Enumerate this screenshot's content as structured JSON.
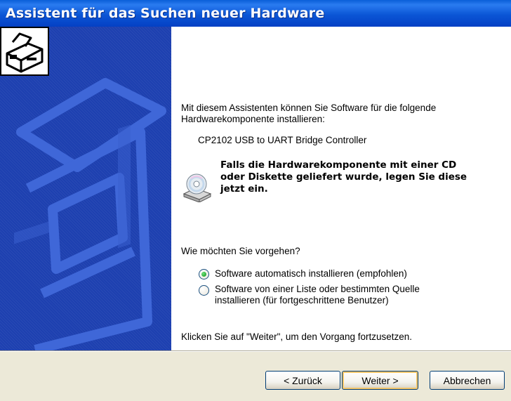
{
  "window": {
    "title": "Assistent für das Suchen neuer Hardware"
  },
  "content": {
    "intro_line1": "Mit diesem Assistenten können Sie Software für die folgende",
    "intro_line2": "Hardwarekomponente installieren:",
    "device_name": "CP2102 USB to UART Bridge Controller",
    "cd_notice_line1": "Falls die Hardwarekomponente mit einer CD",
    "cd_notice_line2": "oder Diskette geliefert wurde, legen Sie diese",
    "cd_notice_line3": "jetzt ein.",
    "question": "Wie möchten Sie vorgehen?",
    "options": [
      {
        "label": "Software automatisch installieren (empfohlen)",
        "selected": true
      },
      {
        "label_line1": "Software von einer Liste oder bestimmten Quelle",
        "label_line2": "installieren (für fortgeschrittene Benutzer)",
        "selected": false
      }
    ],
    "continue_hint": "Klicken Sie auf \"Weiter\", um den Vorgang fortzusetzen."
  },
  "footer": {
    "back_label": "< Zurück",
    "next_label": "Weiter >",
    "cancel_label": "Abbrechen"
  },
  "icons": {
    "wizard": "hardware-box-icon",
    "cd": "cd-drive-icon"
  },
  "colors": {
    "title_bar": "#0b56d6",
    "side_panel": "#1d40b0",
    "footer": "#ece9d8",
    "radio_selected": "#21a12d"
  }
}
